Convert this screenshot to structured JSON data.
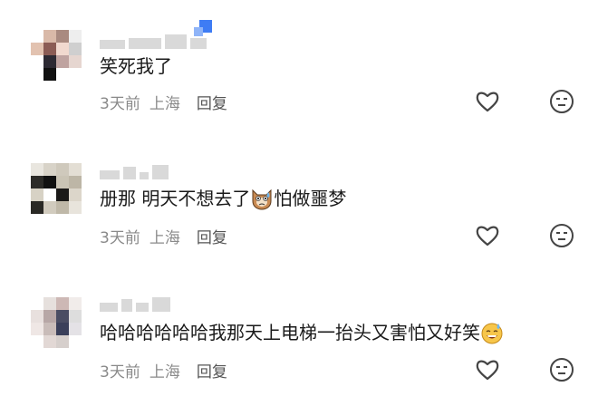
{
  "comments": [
    {
      "text": "笑死我了",
      "time": "3天前",
      "location": "上海",
      "reply": "回复",
      "avatar_colors": [
        "#fff",
        "#d9b9a8",
        "#a98a80",
        "#eee",
        "#e2c2b0",
        "#8b5c55",
        "#f1d9cf",
        "#cfcfcf",
        "#fff",
        "#2d2a33",
        "#bfa3a0",
        "#e6d6d0",
        "#fff",
        "#111",
        "#fff",
        "#fff"
      ]
    },
    {
      "text_before": "册那 明天不想去了",
      "emoji_name": "crying-cat-emoji",
      "text_after": "怕做噩梦",
      "time": "3天前",
      "location": "上海",
      "reply": "回复",
      "avatar_colors": [
        "#e9e6df",
        "#d8d3c8",
        "#cfc9bc",
        "#e3ded4",
        "#2c2b28",
        "#111",
        "#cac4b5",
        "#bdb6a6",
        "#d7d2c5",
        "#fff",
        "#1b1a18",
        "#dcd6ca",
        "#2a2925",
        "#d1cbbe",
        "#bfb8a8",
        "#e8e4dc"
      ]
    },
    {
      "text": "哈哈哈哈哈哈我那天上电梯一抬头又害怕又好笑",
      "emoji_name": "sweat-smile-emoji",
      "time": "3天前",
      "location": "上海",
      "reply": "回复",
      "avatar_colors": [
        "#fff",
        "#e6e0dd",
        "#cdb8b5",
        "#f1ecea",
        "#e8e0de",
        "#b7a7a6",
        "#4a4d63",
        "#ddd",
        "#efe7e5",
        "#c9bcb9",
        "#3a3f5a",
        "#e4e2e6",
        "#fff",
        "#e2d8d5",
        "#d6cfcc",
        "#fff"
      ]
    }
  ],
  "colors": {
    "badge": "#3e7cf4",
    "icon": "#444444"
  }
}
